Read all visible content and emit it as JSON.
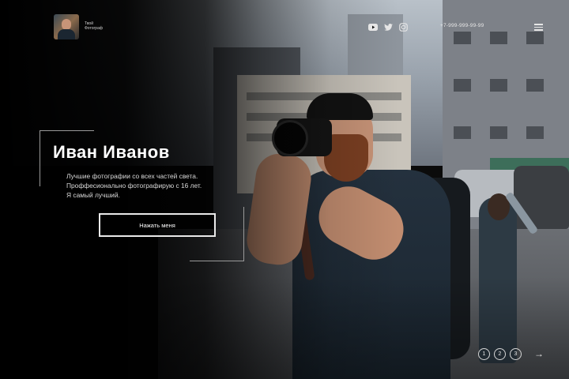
{
  "header": {
    "brand_line1": "Твой",
    "brand_line2": "Фотограф",
    "phone": "+7-999-999-99-99",
    "socials": [
      {
        "icon": "youtube-icon"
      },
      {
        "icon": "twitter-icon"
      },
      {
        "icon": "instagram-icon"
      }
    ],
    "menu_icon": "hamburger-menu-icon"
  },
  "hero": {
    "title": "Иван Иванов",
    "subtitle_lines": [
      "Лучшие фотографии со всех частей света.",
      "Проффесионально фотографирую с 16 лет.",
      "Я самый лучший."
    ],
    "cta_label": "Нажать меня"
  },
  "slider": {
    "pages": [
      "1",
      "2",
      "3"
    ],
    "next_arrow": "→"
  },
  "colors": {
    "background": "#0b0b0b",
    "text": "#ffffff",
    "subtext": "#d9d9d9",
    "frame_lines": "#9a9a9a"
  }
}
